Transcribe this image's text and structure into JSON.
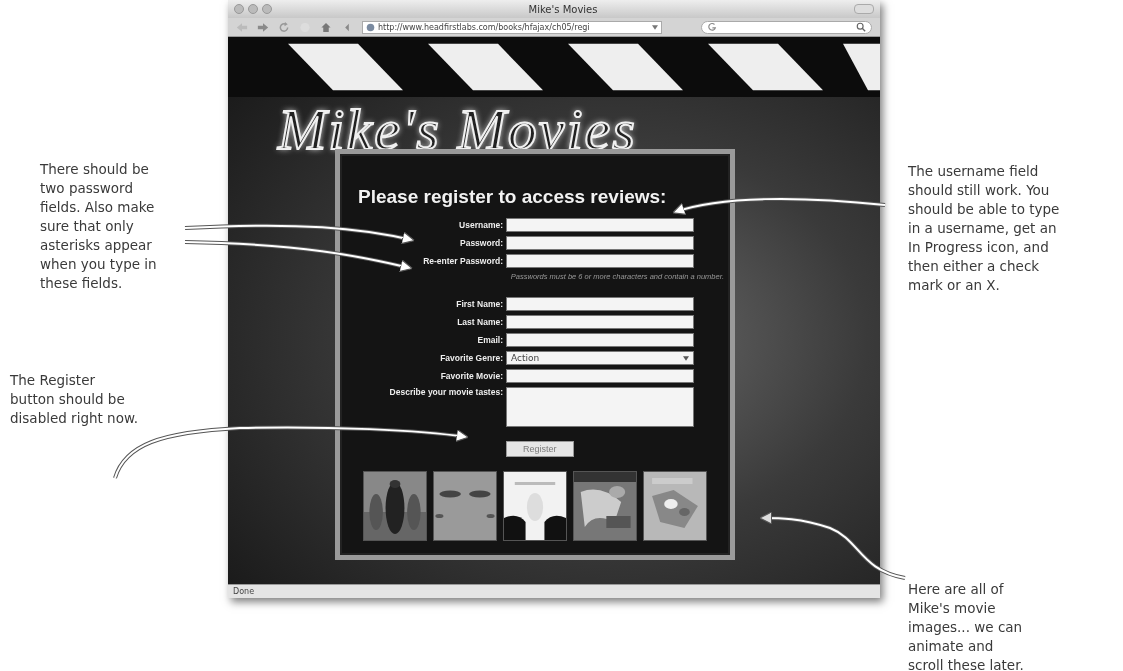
{
  "window": {
    "title": "Mike's Movies",
    "url": "http://www.headfirstlabs.com/books/hfajax/ch05/regi",
    "status": "Done"
  },
  "page": {
    "logo": "Mike's Movies",
    "heading": "Please register to access reviews:",
    "fields": [
      {
        "kind": "text",
        "label": "Username:"
      },
      {
        "kind": "text",
        "label": "Password:"
      },
      {
        "kind": "text",
        "label": "Re-enter Password:"
      },
      {
        "kind": "hint",
        "text": "Passwords must be 6 or more characters and contain a number."
      },
      {
        "kind": "text",
        "label": "First Name:"
      },
      {
        "kind": "text",
        "label": "Last Name:"
      },
      {
        "kind": "text",
        "label": "Email:"
      },
      {
        "kind": "select",
        "label": "Favorite Genre:",
        "value": "Action"
      },
      {
        "kind": "text",
        "label": "Favorite Movie:"
      },
      {
        "kind": "textarea",
        "label": "Describe your movie tastes:"
      }
    ],
    "register_button": {
      "label": "Register",
      "disabled": true
    }
  },
  "left_notes": [
    {
      "lines": [
        "There should be",
        "two password",
        "fields. Also make",
        "sure that only",
        "asterisks appear",
        "when you type in",
        "these fields."
      ]
    },
    {
      "lines": [
        "The Register",
        "button should be",
        "disabled right now."
      ]
    }
  ],
  "right_notes": [
    {
      "lines": [
        "The username field",
        "should still work. You",
        "should be able to type",
        "in a username, get an",
        "In Progress icon, and",
        "then either a check",
        "mark or an X."
      ]
    },
    {
      "lines": [
        "Here are all of",
        "Mike's movie",
        "images... we can",
        "animate and",
        "scroll these later."
      ]
    }
  ]
}
